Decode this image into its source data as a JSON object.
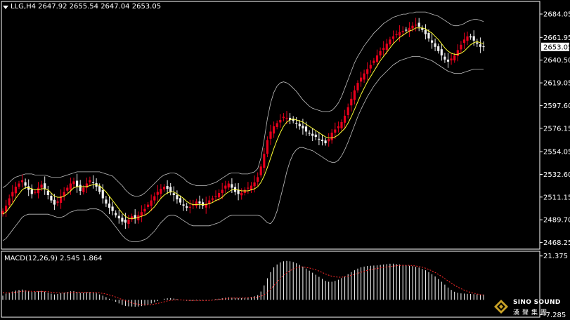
{
  "header": {
    "symbol_line": "LLG,H4  2647.92 2655.54 2647.04 2653.05",
    "macd_line": "MACD(12,26,9) 2.545 1.864"
  },
  "logo": {
    "brand": "SINO SOUND",
    "brand_cn": "漢聲集團"
  },
  "colors": {
    "background": "#000000",
    "up_candle": "#e8001c",
    "down_candle": "#f0f0f0",
    "bullish_body_outline": "#ff2020",
    "ma_fast": "#ffff33",
    "bands": "#c0c0c0",
    "macd_hist": "#ffffff",
    "macd_signal": "#ff2a2a",
    "grid": "#ffffff"
  },
  "chart_data": [
    {
      "type": "candlestick",
      "title": "LLG,H4",
      "ohlc_last": {
        "open": 2647.92,
        "high": 2655.54,
        "low": 2647.04,
        "close": 2653.05
      },
      "current_price_label": "2653.05",
      "ylim": [
        2462,
        2692
      ],
      "y_ticks": [
        "2684.05",
        "2661.95",
        "2640.50",
        "2619.05",
        "2597.60",
        "2576.15",
        "2554.05",
        "2532.60",
        "2511.15",
        "2489.70",
        "2468.25"
      ],
      "y_tick_values": [
        2684.05,
        2661.95,
        2640.5,
        2619.05,
        2597.6,
        2576.15,
        2554.05,
        2532.6,
        2511.15,
        2489.7,
        2468.25
      ],
      "x_count": 168,
      "series": [
        {
          "name": "close",
          "values": [
            2498,
            2503,
            2510,
            2516,
            2521,
            2524,
            2527,
            2522,
            2518,
            2514,
            2516,
            2520,
            2523,
            2519,
            2513,
            2508,
            2504,
            2507,
            2512,
            2516,
            2520,
            2524,
            2526,
            2521,
            2517,
            2520,
            2524,
            2527,
            2525,
            2521,
            2516,
            2510,
            2505,
            2501,
            2498,
            2494,
            2491,
            2488,
            2487,
            2490,
            2493,
            2491,
            2494,
            2497,
            2500,
            2504,
            2508,
            2512,
            2516,
            2519,
            2521,
            2519,
            2516,
            2513,
            2509,
            2506,
            2503,
            2501,
            2502,
            2504,
            2507,
            2505,
            2503,
            2505,
            2508,
            2510,
            2512,
            2515,
            2518,
            2522,
            2524,
            2520,
            2516,
            2514,
            2515,
            2518,
            2520,
            2522,
            2525,
            2530,
            2540,
            2552,
            2565,
            2573,
            2578,
            2581,
            2584,
            2587,
            2586,
            2584,
            2583,
            2581,
            2578,
            2576,
            2573,
            2571,
            2569,
            2568,
            2566,
            2564,
            2562,
            2566,
            2572,
            2575,
            2578,
            2582,
            2588,
            2596,
            2604,
            2612,
            2619,
            2624,
            2628,
            2632,
            2636,
            2640,
            2645,
            2649,
            2652,
            2656,
            2660,
            2663,
            2665,
            2667,
            2668,
            2669,
            2671,
            2673,
            2674,
            2672,
            2669,
            2665,
            2661,
            2657,
            2653,
            2649,
            2645,
            2641,
            2639,
            2642,
            2645,
            2650,
            2655,
            2660,
            2663,
            2662,
            2659,
            2656,
            2653,
            2653
          ]
        },
        {
          "name": "MA fast",
          "values": [
            2495,
            2497,
            2501,
            2505,
            2510,
            2514,
            2518,
            2520,
            2520,
            2519,
            2518,
            2518,
            2519,
            2519,
            2518,
            2515,
            2512,
            2511,
            2511,
            2512,
            2514,
            2517,
            2520,
            2521,
            2521,
            2521,
            2521,
            2522,
            2523,
            2523,
            2522,
            2519,
            2516,
            2512,
            2508,
            2504,
            2500,
            2496,
            2493,
            2491,
            2491,
            2491,
            2492,
            2493,
            2494,
            2496,
            2499,
            2502,
            2506,
            2510,
            2513,
            2515,
            2516,
            2516,
            2514,
            2512,
            2510,
            2507,
            2505,
            2504,
            2504,
            2504,
            2504,
            2504,
            2505,
            2506,
            2508,
            2509,
            2511,
            2514,
            2516,
            2518,
            2518,
            2518,
            2517,
            2517,
            2517,
            2518,
            2519,
            2521,
            2525,
            2531,
            2539,
            2548,
            2557,
            2565,
            2572,
            2578,
            2582,
            2584,
            2585,
            2584,
            2583,
            2582,
            2580,
            2578,
            2576,
            2574,
            2572,
            2570,
            2568,
            2567,
            2567,
            2568,
            2570,
            2573,
            2576,
            2581,
            2587,
            2594,
            2601,
            2608,
            2614,
            2620,
            2625,
            2630,
            2635,
            2640,
            2644,
            2648,
            2652,
            2656,
            2659,
            2662,
            2664,
            2666,
            2668,
            2669,
            2671,
            2671,
            2671,
            2670,
            2668,
            2666,
            2663,
            2660,
            2656,
            2652,
            2649,
            2647,
            2646,
            2646,
            2647,
            2649,
            2652,
            2655,
            2657,
            2658,
            2657,
            2656
          ]
        },
        {
          "name": "Bands upper",
          "values": [
            2520,
            2522,
            2525,
            2528,
            2530,
            2531,
            2532,
            2533,
            2533,
            2533,
            2532,
            2532,
            2532,
            2532,
            2531,
            2530,
            2530,
            2530,
            2530,
            2531,
            2532,
            2533,
            2534,
            2535,
            2535,
            2535,
            2535,
            2535,
            2535,
            2535,
            2535,
            2534,
            2533,
            2532,
            2531,
            2528,
            2525,
            2522,
            2518,
            2515,
            2513,
            2512,
            2512,
            2513,
            2515,
            2518,
            2521,
            2524,
            2527,
            2530,
            2532,
            2533,
            2534,
            2534,
            2533,
            2531,
            2529,
            2526,
            2524,
            2523,
            2522,
            2522,
            2522,
            2522,
            2523,
            2524,
            2525,
            2527,
            2529,
            2531,
            2533,
            2534,
            2534,
            2534,
            2533,
            2533,
            2533,
            2534,
            2535,
            2538,
            2548,
            2565,
            2585,
            2600,
            2610,
            2616,
            2619,
            2620,
            2619,
            2617,
            2614,
            2611,
            2607,
            2603,
            2600,
            2597,
            2595,
            2594,
            2593,
            2592,
            2592,
            2592,
            2593,
            2596,
            2600,
            2606,
            2614,
            2622,
            2630,
            2638,
            2644,
            2649,
            2654,
            2658,
            2662,
            2666,
            2669,
            2672,
            2675,
            2677,
            2679,
            2681,
            2682,
            2683,
            2684,
            2684,
            2685,
            2685,
            2686,
            2686,
            2686,
            2686,
            2685,
            2684,
            2683,
            2682,
            2680,
            2678,
            2676,
            2674,
            2673,
            2673,
            2674,
            2675,
            2677,
            2678,
            2679,
            2679,
            2678,
            2677
          ]
        },
        {
          "name": "Bands lower",
          "values": [
            2470,
            2472,
            2476,
            2480,
            2484,
            2488,
            2492,
            2494,
            2495,
            2495,
            2495,
            2495,
            2495,
            2495,
            2495,
            2494,
            2493,
            2492,
            2492,
            2493,
            2495,
            2497,
            2498,
            2499,
            2499,
            2499,
            2499,
            2500,
            2500,
            2500,
            2499,
            2497,
            2494,
            2491,
            2487,
            2483,
            2479,
            2475,
            2472,
            2470,
            2469,
            2469,
            2469,
            2470,
            2471,
            2473,
            2476,
            2479,
            2483,
            2487,
            2490,
            2493,
            2494,
            2494,
            2493,
            2491,
            2489,
            2487,
            2485,
            2484,
            2484,
            2484,
            2484,
            2484,
            2484,
            2485,
            2486,
            2487,
            2489,
            2491,
            2493,
            2494,
            2494,
            2494,
            2494,
            2494,
            2494,
            2494,
            2494,
            2494,
            2493,
            2490,
            2487,
            2486,
            2490,
            2498,
            2510,
            2522,
            2535,
            2545,
            2552,
            2556,
            2558,
            2558,
            2557,
            2556,
            2555,
            2553,
            2551,
            2549,
            2547,
            2545,
            2544,
            2544,
            2546,
            2550,
            2556,
            2563,
            2571,
            2579,
            2587,
            2594,
            2600,
            2606,
            2611,
            2616,
            2620,
            2624,
            2627,
            2630,
            2633,
            2636,
            2638,
            2640,
            2641,
            2642,
            2643,
            2644,
            2644,
            2644,
            2643,
            2642,
            2641,
            2640,
            2638,
            2636,
            2634,
            2632,
            2630,
            2629,
            2628,
            2628,
            2628,
            2629,
            2630,
            2631,
            2632,
            2632,
            2632,
            2632
          ]
        }
      ]
    },
    {
      "type": "bar",
      "title": "MACD(12,26,9)",
      "values_last": {
        "macd": 2.545,
        "signal": 1.864
      },
      "ylim": [
        -8.5,
        23
      ],
      "y_ticks": [
        "21.375",
        "-7.285"
      ],
      "y_tick_values": [
        21.375,
        -7.285
      ],
      "series": [
        {
          "name": "MACD",
          "values": [
            2,
            3,
            3.5,
            4,
            4.5,
            4.8,
            5,
            4.6,
            4.2,
            3.8,
            3.9,
            4.1,
            4.3,
            4,
            3.5,
            3,
            2.6,
            2.8,
            3.2,
            3.5,
            3.8,
            4.1,
            4.2,
            3.8,
            3.4,
            3.5,
            3.7,
            3.8,
            3.6,
            3.2,
            2.6,
            2,
            1.3,
            0.5,
            -0.2,
            -1,
            -1.8,
            -2.5,
            -3,
            -3.2,
            -3.3,
            -3.4,
            -3.3,
            -3.1,
            -2.8,
            -2.3,
            -1.8,
            -1.2,
            -0.6,
            0,
            0.5,
            0.7,
            0.8,
            0.6,
            0.3,
            0,
            -0.3,
            -0.5,
            -0.6,
            -0.5,
            -0.3,
            -0.3,
            -0.4,
            -0.3,
            -0.1,
            0.1,
            0.3,
            0.5,
            0.7,
            1,
            1.2,
            1.1,
            0.9,
            0.8,
            0.8,
            1,
            1.2,
            1.4,
            1.7,
            2.3,
            4,
            7,
            10.5,
            13.5,
            15.8,
            17.2,
            18.2,
            18.8,
            19,
            18.8,
            18.4,
            17.8,
            17,
            16.2,
            15.2,
            14.2,
            13.2,
            12.2,
            11.2,
            10.2,
            9.2,
            8.8,
            8.8,
            9.2,
            9.8,
            10.6,
            11.5,
            12.5,
            13.5,
            14.4,
            15.2,
            15.8,
            16.2,
            16.5,
            16.6,
            16.7,
            16.8,
            17,
            17.2,
            17.4,
            17.6,
            17.6,
            17.4,
            17.2,
            17,
            16.8,
            16.6,
            16.4,
            16.1,
            15.7,
            15.1,
            14.4,
            13.5,
            12.5,
            11.4,
            10.1,
            8.8,
            7.4,
            6,
            4.8,
            3.9,
            3.4,
            3.1,
            3,
            2.9,
            2.8,
            2.7,
            2.6,
            2.55,
            2.545
          ]
        },
        {
          "name": "Signal",
          "values": [
            3.5,
            3.4,
            3.4,
            3.5,
            3.7,
            3.9,
            4.1,
            4.2,
            4.2,
            4.1,
            4,
            4,
            4,
            4,
            3.9,
            3.7,
            3.5,
            3.4,
            3.3,
            3.3,
            3.4,
            3.5,
            3.6,
            3.7,
            3.7,
            3.6,
            3.6,
            3.6,
            3.6,
            3.6,
            3.4,
            3.1,
            2.8,
            2.4,
            1.9,
            1.3,
            0.7,
            0.1,
            -0.5,
            -1,
            -1.5,
            -1.9,
            -2.2,
            -2.4,
            -2.5,
            -2.5,
            -2.4,
            -2.1,
            -1.8,
            -1.4,
            -1,
            -0.6,
            -0.3,
            -0.1,
            0,
            0,
            -0.1,
            -0.2,
            -0.3,
            -0.4,
            -0.4,
            -0.4,
            -0.4,
            -0.4,
            -0.3,
            -0.2,
            0,
            0.1,
            0.3,
            0.5,
            0.7,
            0.8,
            0.8,
            0.8,
            0.8,
            0.8,
            0.9,
            1,
            1.1,
            1.3,
            1.7,
            2.4,
            3.6,
            5.1,
            6.9,
            8.7,
            10.4,
            11.9,
            13.2,
            14.2,
            15,
            15.6,
            15.9,
            16,
            15.8,
            15.5,
            15.1,
            14.6,
            14,
            13.3,
            12.6,
            12,
            11.5,
            11.2,
            11,
            11,
            11.2,
            11.5,
            11.9,
            12.4,
            12.9,
            13.4,
            13.9,
            14.3,
            14.7,
            15,
            15.3,
            15.6,
            15.8,
            16,
            16.2,
            16.4,
            16.6,
            16.7,
            16.8,
            16.8,
            16.8,
            16.7,
            16.5,
            16.2,
            15.9,
            15.4,
            14.8,
            14.1,
            13.3,
            12.4,
            11.4,
            10.3,
            9.2,
            8.1,
            7.1,
            6.2,
            5.4,
            4.7,
            4.1,
            3.6,
            3.2,
            2.8,
            2.5,
            2.3
          ]
        }
      ]
    }
  ]
}
